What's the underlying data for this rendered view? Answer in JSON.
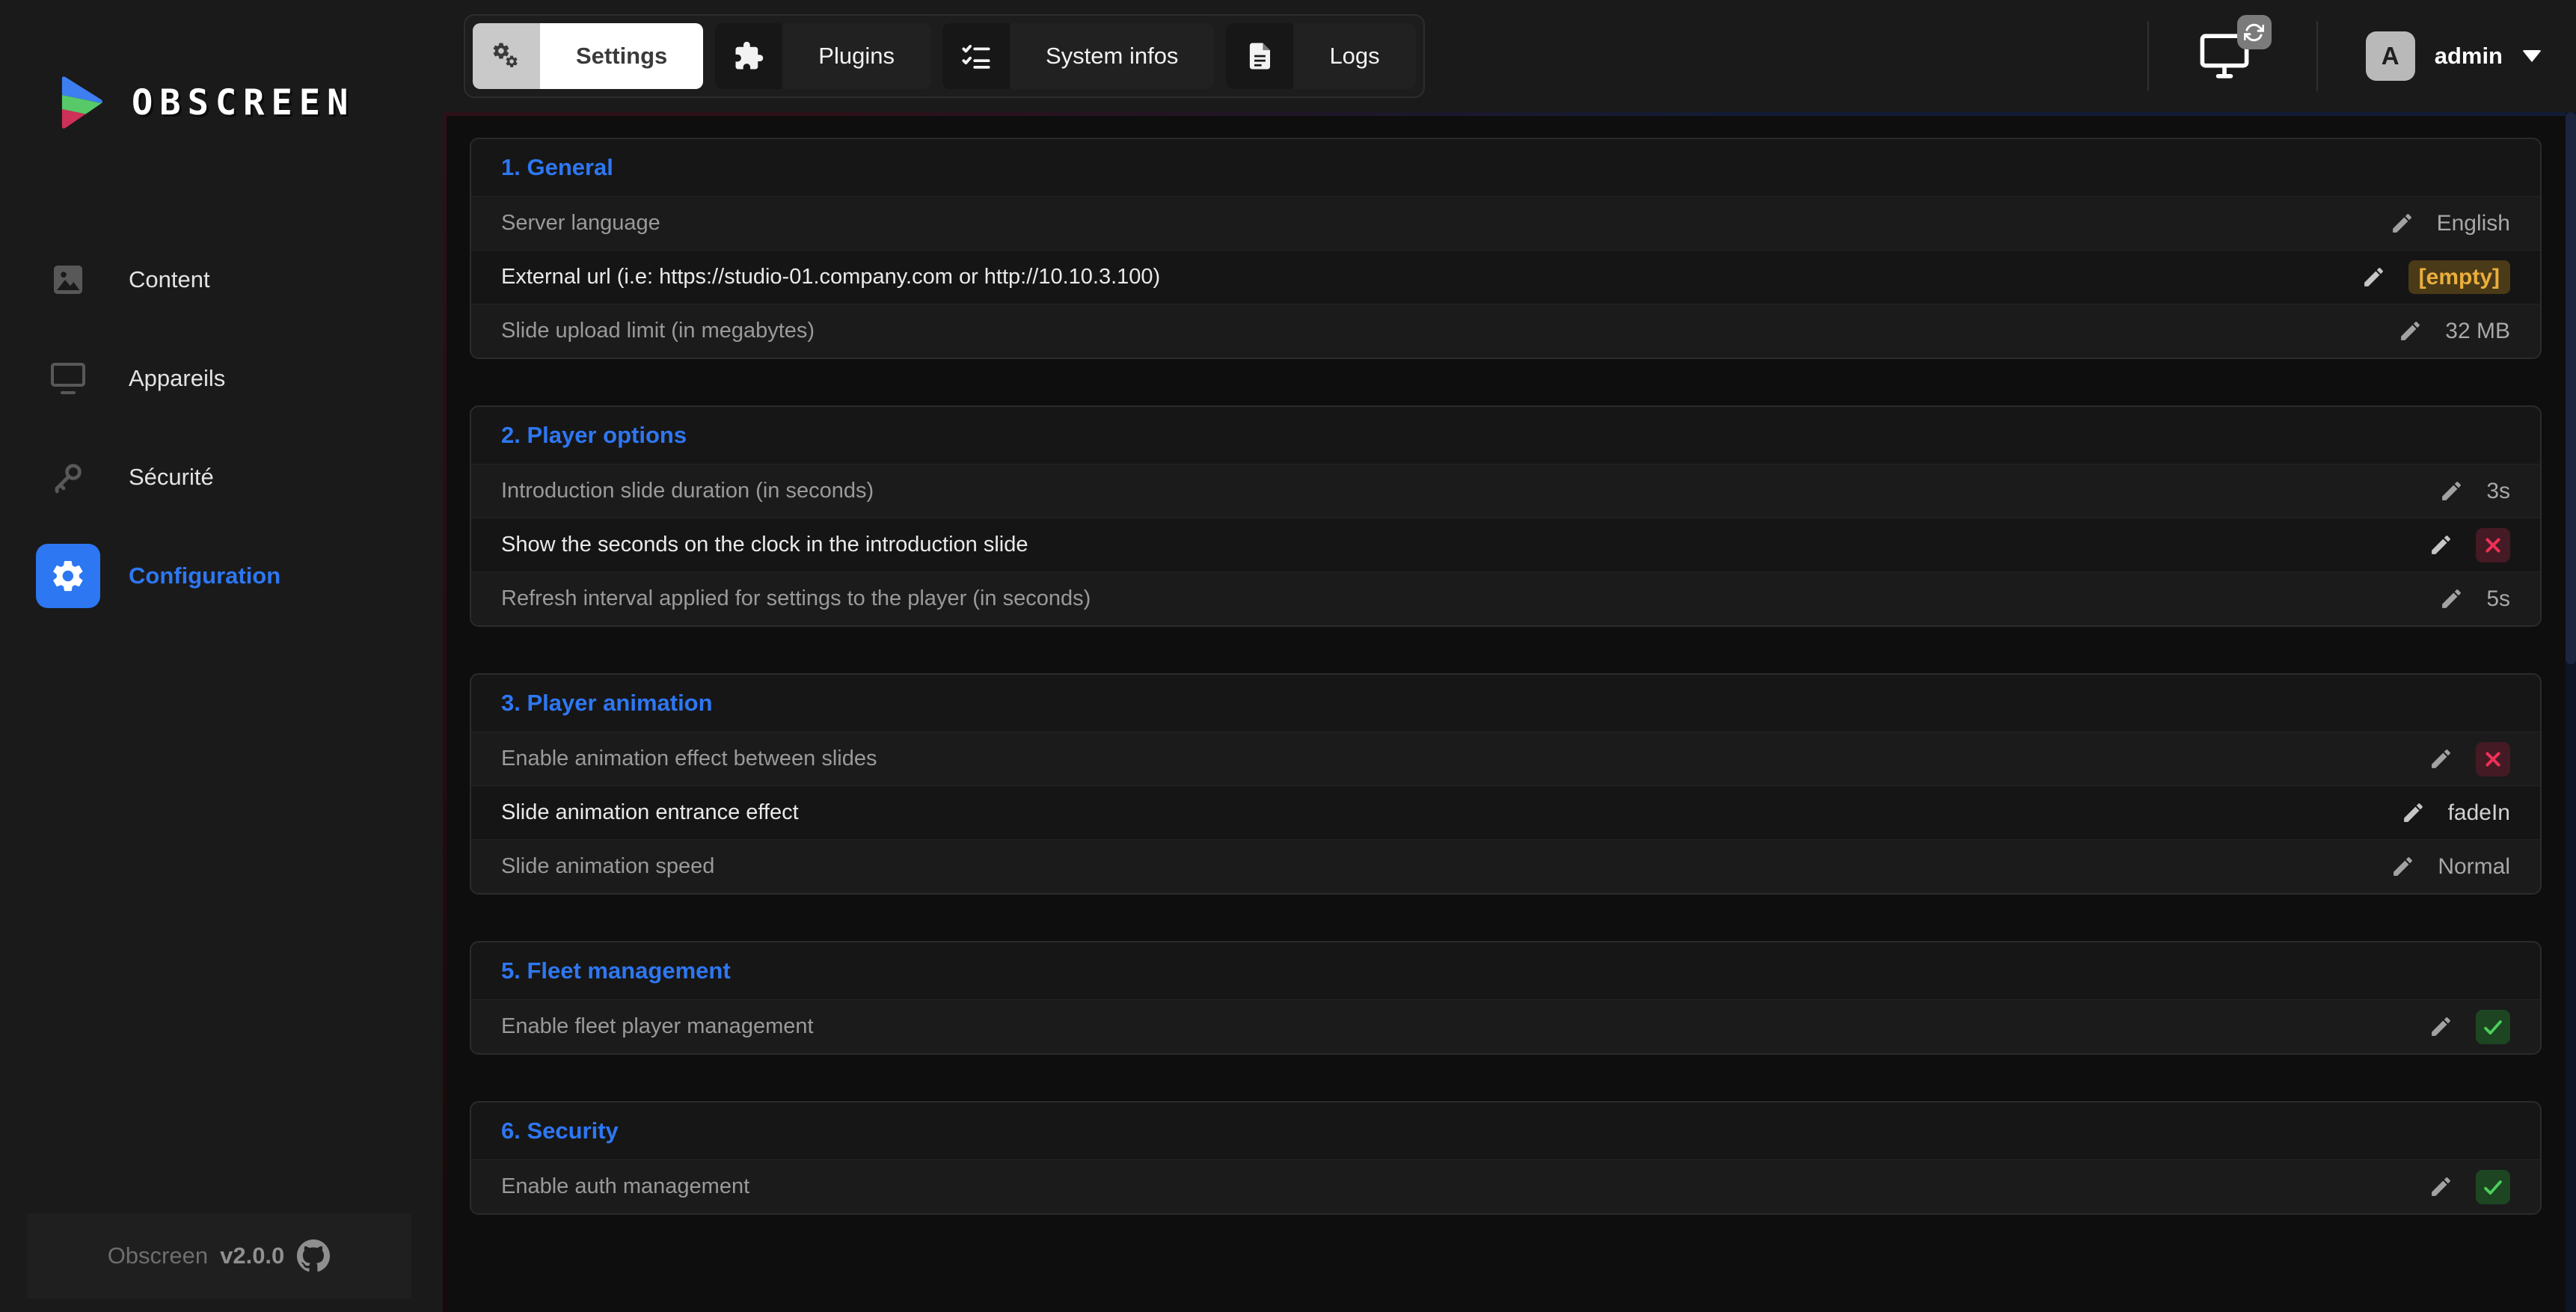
{
  "colors": {
    "accent": "#2e77f2",
    "warn": "#eaae3d",
    "warn_bg": "#4a3a17",
    "danger": "#ef3056",
    "danger_bg": "#441a24",
    "ok": "#49d15a",
    "ok_bg": "#1d4522"
  },
  "logo": {
    "text": "OBSCREEN"
  },
  "sidebar": {
    "items": [
      {
        "label": "Content",
        "icon": "image",
        "active": false
      },
      {
        "label": "Appareils",
        "icon": "monitor",
        "active": false
      },
      {
        "label": "Sécurité",
        "icon": "key",
        "active": false
      },
      {
        "label": "Configuration",
        "icon": "gear",
        "active": true
      }
    ],
    "footer": {
      "app": "Obscreen",
      "version": "v2.0.0"
    }
  },
  "topbar": {
    "tabs": [
      {
        "label": "Settings",
        "icon": "gears",
        "active": true
      },
      {
        "label": "Plugins",
        "icon": "puzzle",
        "active": false
      },
      {
        "label": "System infos",
        "icon": "checklist",
        "active": false
      },
      {
        "label": "Logs",
        "icon": "document",
        "active": false
      }
    ],
    "user": {
      "avatar_initial": "A",
      "name": "admin"
    }
  },
  "sections": [
    {
      "title": "1. General",
      "rows": [
        {
          "label": "Server language",
          "value": {
            "type": "text",
            "text": "English"
          }
        },
        {
          "label": "External url (i.e: https://studio-01.company.com or http://10.10.3.100)",
          "value": {
            "type": "empty",
            "text": "[empty]"
          }
        },
        {
          "label": "Slide upload limit (in megabytes)",
          "value": {
            "type": "text",
            "text": "32 MB"
          }
        }
      ]
    },
    {
      "title": "2. Player options",
      "rows": [
        {
          "label": "Introduction slide duration (in seconds)",
          "value": {
            "type": "text",
            "text": "3s"
          }
        },
        {
          "label": "Show the seconds on the clock in the introduction slide",
          "value": {
            "type": "cross"
          }
        },
        {
          "label": "Refresh interval applied for settings to the player (in seconds)",
          "value": {
            "type": "text",
            "text": "5s"
          }
        }
      ]
    },
    {
      "title": "3. Player animation",
      "rows": [
        {
          "label": "Enable animation effect between slides",
          "value": {
            "type": "cross"
          }
        },
        {
          "label": "Slide animation entrance effect",
          "value": {
            "type": "text",
            "text": "fadeIn"
          }
        },
        {
          "label": "Slide animation speed",
          "value": {
            "type": "text",
            "text": "Normal"
          }
        }
      ]
    },
    {
      "title": "5. Fleet management",
      "rows": [
        {
          "label": "Enable fleet player management",
          "value": {
            "type": "check"
          }
        }
      ]
    },
    {
      "title": "6. Security",
      "rows": [
        {
          "label": "Enable auth management",
          "value": {
            "type": "check"
          }
        }
      ]
    }
  ]
}
